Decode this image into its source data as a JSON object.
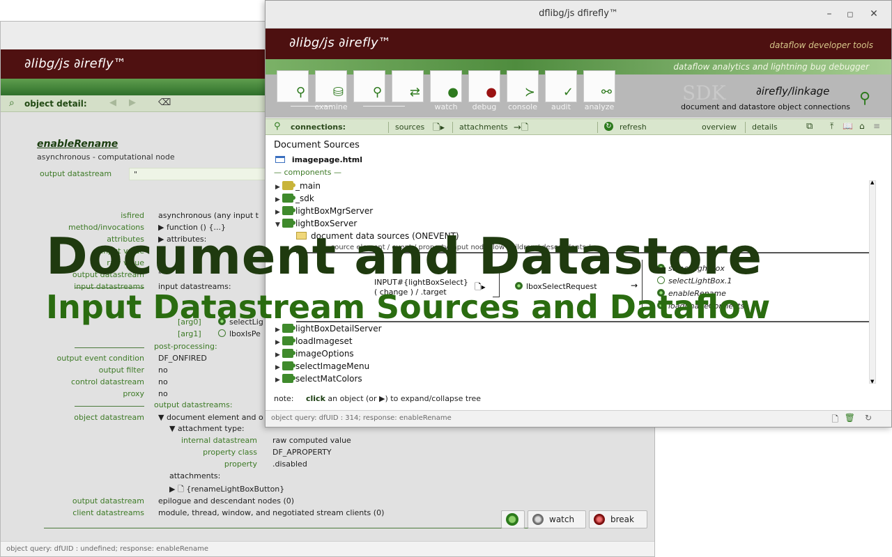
{
  "back_window": {
    "brand": "∂libg/js  ∂irefly™",
    "detail_label": "object detail:",
    "object_name": "enableRename",
    "object_subtitle": "asynchronous - computational node",
    "output_datastream_label": "output  datastream",
    "output_datastream_value": "\"",
    "rows": [
      {
        "k": "isfired",
        "v": "asynchronous    (any input t"
      },
      {
        "k": "method/invocations",
        "v": "▶ function () {...}"
      },
      {
        "k": "attributes",
        "v": "▶ attributes:"
      },
      {
        "k": "input value",
        "v": "u"
      },
      {
        "k": "raw value",
        "v": "0"
      },
      {
        "k": "output datastream",
        "v": "\""
      },
      {
        "k": "input datastreams",
        "v": "input datastreams:"
      }
    ],
    "args": [
      {
        "k": "[arg0]",
        "v": "selectLig",
        "on": true
      },
      {
        "k": "[arg1]",
        "v": "lboxIsPe",
        "on": false
      }
    ],
    "post_processing_heading": "post-processing:",
    "post_rows": [
      {
        "k": "output event condition",
        "v": "DF_ONFIRED"
      },
      {
        "k": "output filter",
        "v": "no"
      },
      {
        "k": "control datastream",
        "v": "no"
      },
      {
        "k": "proxy",
        "v": "no"
      }
    ],
    "output_datastreams_heading": "output datastreams:",
    "object_datastream_label": "object datastream",
    "object_datastream_value": "▼ document element and o",
    "attachment_type": "▼ attachment type:",
    "attach_rows": [
      {
        "k": "internal datastream",
        "v": "raw computed value"
      },
      {
        "k": "property class",
        "v": "DF_APROPERTY"
      },
      {
        "k": "property",
        "v": ".disabled"
      }
    ],
    "attachments_label": "attachments:",
    "attachment_item": "▶ 🗋 {renameLightBoxButton}",
    "tail_rows": [
      {
        "k": "output datastream",
        "v": "epilogue and descendant nodes (0)"
      },
      {
        "k": "client datastreams",
        "v": "module, thread, window, and negotiated stream clients (0)"
      }
    ],
    "buttons": {
      "refresh": "",
      "watch": "watch",
      "break": "break"
    },
    "status": "object query: dfUID : undefined; response: enableRename"
  },
  "front_window": {
    "title": "dflibg/js dfirefly™",
    "brand": "∂libg/js  ∂irefly™",
    "tagline": "dataflow developer tools",
    "subtagline": "dataflow analytics and lightning bug debugger",
    "tools": [
      {
        "label": "",
        "icon": "magnifier-icon"
      },
      {
        "label": "examine",
        "icon": "database-icon"
      },
      {
        "label": "",
        "icon": "inspect-icon"
      },
      {
        "label": "",
        "icon": "refresh-arrows-icon"
      },
      {
        "label": "watch",
        "icon": "green-dot-icon"
      },
      {
        "label": "debug",
        "icon": "red-dot-icon"
      },
      {
        "label": "console",
        "icon": "console-icon"
      },
      {
        "label": "audit",
        "icon": "checkmark-icon"
      },
      {
        "label": "analyze",
        "icon": "graph-icon"
      }
    ],
    "sdk_watermark": "SDK",
    "linkage_title": "∂irefly/linkage",
    "linkage_subtitle": "document and datastore object connections",
    "connbar": {
      "connections": "connections:",
      "sources": "sources",
      "attachments": "attachments",
      "refresh": "refresh",
      "overview": "overview",
      "details": "details"
    },
    "doc_sources_title": "Document Sources",
    "page_file": "imagepage.html",
    "components_label": "— components —",
    "tree_top": [
      {
        "name": "_main",
        "open": false,
        "yellow": true
      },
      {
        "name": "_sdk",
        "open": false,
        "yellow": false
      },
      {
        "name": "lightBoxMgrServer",
        "open": false,
        "yellow": false
      },
      {
        "name": "lightBoxServer",
        "open": true,
        "yellow": false
      }
    ],
    "sub_node": "document data sources (ONEVENT)",
    "columns_header": "source element  /  event  /  property        input node              flow  children / descendants / ...",
    "flow": {
      "input_line1": "INPUT#{lightBoxSelect}",
      "input_line2": "( change  )    /   .target",
      "node": "lboxSelectRequest",
      "children": [
        "selectLightBox",
        "selectLightBox.1",
        "enableRename",
        "loadImageConnects"
      ]
    },
    "tree_bottom": [
      {
        "name": "lightBoxDetailServer"
      },
      {
        "name": "loadImageset"
      },
      {
        "name": "imageOptions"
      },
      {
        "name": "selectImageMenu"
      },
      {
        "name": "selectMatColors"
      }
    ],
    "note_label": "note:",
    "note_bold": "click",
    "note_text": " an object (or ▶) to expand/collapse tree",
    "status": "object query: dfUID : 314; response: enableRename"
  },
  "overlay": {
    "line1": "Document and Datastore",
    "line2": "Input Datastream Sources and Dataflow"
  },
  "colors": {
    "brand": "#4f1111",
    "accent_green": "#3f8a2c",
    "overlay_dark": "#1f3a0f",
    "overlay_green": "#2a6c10"
  }
}
